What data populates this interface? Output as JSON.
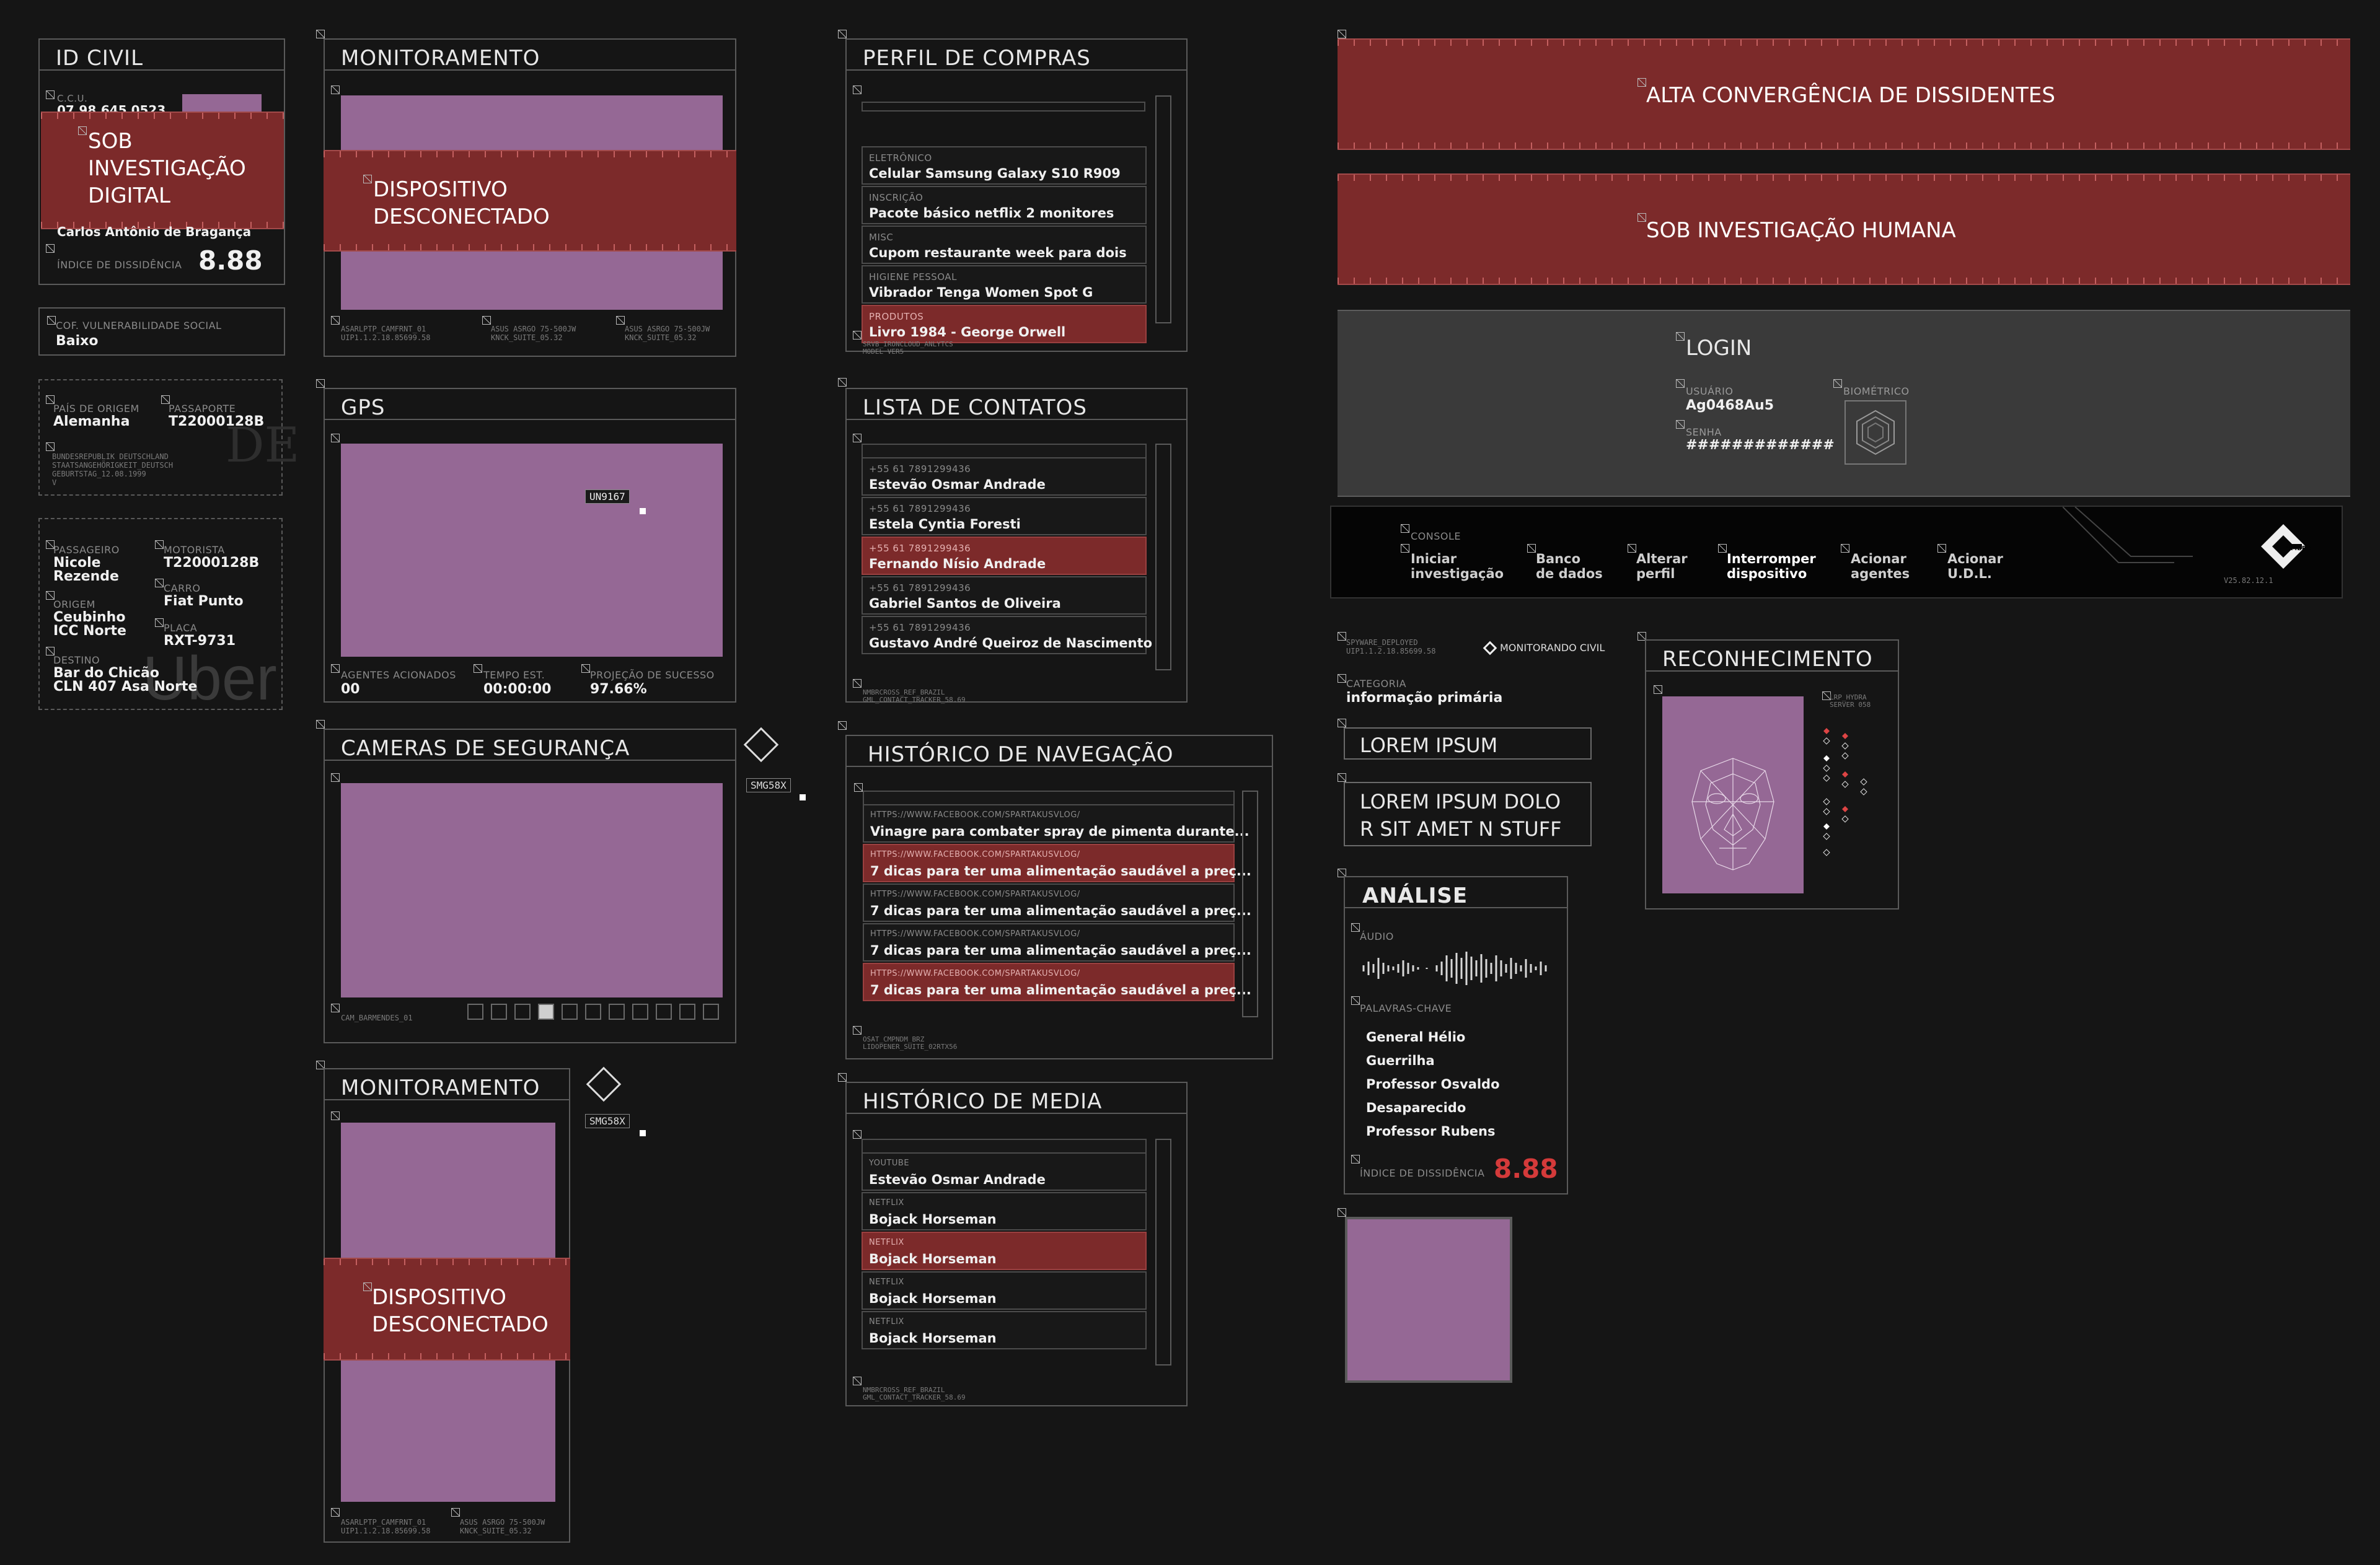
{
  "id_civil": {
    "title": "ID CIVIL",
    "ccu_label": "C.C.U.",
    "ccu_value": "07.98.645 0523",
    "alert": "SOB\nINVESTIGAÇÃO\nDIGITAL",
    "name": "Carlos Antônio de Bragança",
    "dissidence_label": "ÍNDICE DE DISSIDÊNCIA",
    "dissidence_value": "8.88"
  },
  "vulnerability": {
    "label": "COF. VULNERABILIDADE SOCIAL",
    "value": "Baixo"
  },
  "passport": {
    "origin_label": "PAÍS DE ORIGEM",
    "origin_value": "Alemanha",
    "passport_label": "PASSAPORTE",
    "passport_value": "T22000128B",
    "small": "BUNDESREPUBLIK DEUTSCHLAND\nSTAATSANGEHÖRIGKEIT_DEUTSCH\nGEBURTSTAG_12.08.1999\nV",
    "logo": "DE"
  },
  "uber": {
    "passenger_label": "PASSAGEIRO",
    "passenger_value": "Nicole\nRezende",
    "driver_label": "MOTORISTA",
    "driver_value": "T22000128B",
    "car_label": "CARRO",
    "car_value": "Fiat Punto",
    "origin_label": "ORIGEM",
    "origin_value": "Ceubinho\nICC Norte",
    "plate_label": "PLACA",
    "plate_value": "RXT-9731",
    "dest_label": "DESTINO",
    "dest_value": "Bar do Chicão\nCLN 407 Asa Norte",
    "logo": "Uber"
  },
  "monitor1": {
    "title": "MONITORAMENTO",
    "alert": "DISPOSITIVO\nDESCONECTADO",
    "f1": "ASARLPTP_CAMFRNT_01\nUIP1.1.2.18.85699.58",
    "f2": "ASUS ASRGO 75-500JW\nKNCK_SUITE_05.32",
    "f3": "ASUS ASRGO 75-500JW\nKNCK_SUITE_05.32"
  },
  "gps": {
    "title": "GPS",
    "tag": "UN9167",
    "agents_label": "AGENTES ACIONADOS",
    "agents_value": "00",
    "time_label": "TEMPO EST.",
    "time_value": "00:00:00",
    "proj_label": "PROJEÇÃO DE SUCESSO",
    "proj_value": "97.66%"
  },
  "cameras": {
    "title": "CAMERAS DE SEGURANÇA",
    "footer": "CAM_BARMENDES_01",
    "tag": "SMG58X"
  },
  "monitor2": {
    "title": "MONITORAMENTO",
    "alert": "DISPOSITIVO\nDESCONECTADO",
    "f1": "ASARLPTP_CAMFRNT_01\nUIP1.1.2.18.85699.58",
    "f2": "ASUS ASRGO 75-500JW\nKNCK_SUITE_05.32",
    "tag": "SMG58X"
  },
  "compras": {
    "title": "PERFIL DE COMPRAS",
    "rows": [
      {
        "cat": "ELETRÔNICO",
        "item": "Celular Samsung Galaxy S10 R909"
      },
      {
        "cat": "INSCRIÇÃO",
        "item": "Pacote básico netflix 2 monitores"
      },
      {
        "cat": "MISC",
        "item": "Cupom restaurante week para dois"
      },
      {
        "cat": "HIGIENE PESSOAL",
        "item": "Vibrador Tenga Women Spot G"
      },
      {
        "cat": "PRODUTOS",
        "item": "Livro 1984 - George Orwell"
      }
    ],
    "footer": "SRVB_IRONCLOUD_ANLYTCS\nMODEL VER5"
  },
  "contatos": {
    "title": "LISTA DE CONTATOS",
    "rows": [
      {
        "phone": "+55 61 7891299436",
        "name": "Estevão Osmar Andrade"
      },
      {
        "phone": "+55 61 7891299436",
        "name": "Estela Cyntia Foresti"
      },
      {
        "phone": "+55 61 7891299436",
        "name": "Fernando Nísio Andrade"
      },
      {
        "phone": "+55 61 7891299436",
        "name": "Gabriel Santos de Oliveira"
      },
      {
        "phone": "+55 61 7891299436",
        "name": "Gustavo André Queiroz de Nascimento"
      }
    ],
    "footer": "NMBRCROSS_REF_BRAZIL\nGML_CONTACT_TRACKER_58.69"
  },
  "navegacao": {
    "title": "HISTÓRICO DE NAVEGAÇÃO",
    "rows": [
      {
        "url": "HTTPS://WWW.FACEBOOK.COM/SPARTAKUSVLOG/",
        "text": "Vinagre para combater spray de pimenta durante..."
      },
      {
        "url": "HTTPS://WWW.FACEBOOK.COM/SPARTAKUSVLOG/",
        "text": "7 dicas para ter uma alimentação saudável a preç..."
      },
      {
        "url": "HTTPS://WWW.FACEBOOK.COM/SPARTAKUSVLOG/",
        "text": "7 dicas para ter uma alimentação saudável a preç..."
      },
      {
        "url": "HTTPS://WWW.FACEBOOK.COM/SPARTAKUSVLOG/",
        "text": "7 dicas para ter uma alimentação saudável a preç..."
      },
      {
        "url": "HTTPS://WWW.FACEBOOK.COM/SPARTAKUSVLOG/",
        "text": "7 dicas para ter uma alimentação saudável a preç..."
      }
    ],
    "footer": "OSAT_CMPNDM_BRZ\nLIDOPENER_SUITE_02RTX56"
  },
  "media": {
    "title": "HISTÓRICO DE MEDIA",
    "rows": [
      {
        "src": "YOUTUBE",
        "title": "Estevão Osmar Andrade"
      },
      {
        "src": "NETFLIX",
        "title": "Bojack Horseman"
      },
      {
        "src": "NETFLIX",
        "title": "Bojack Horseman"
      },
      {
        "src": "NETFLIX",
        "title": "Bojack Horseman"
      },
      {
        "src": "NETFLIX",
        "title": "Bojack Horseman"
      }
    ],
    "footer": "NMBRCROSS_REF_BRAZIL\nGML_CONTACT_TRACKER_58.69"
  },
  "banner1": "ALTA CONVERGÊNCIA DE DISSIDENTES",
  "banner2": "SOB INVESTIGAÇÃO HUMANA",
  "login": {
    "title": "LOGIN",
    "user_label": "USUÁRIO",
    "user_value": "Ag0468Au5",
    "pass_label": "SENHA",
    "pass_value": "#############",
    "bio_label": "BIOMÉTRICO"
  },
  "console": {
    "label": "CONSOLE",
    "buttons": [
      "Iniciar\ninvestigação",
      "Banco\nde dados",
      "Alterar\nperfil",
      "Interromper\ndispositivo",
      "Acionar\nagentes",
      "Acionar\nU.D.L."
    ],
    "brand": "UMBRA",
    "version": "V25.82.12.1"
  },
  "spyware": {
    "small": "SPYWARE_DEPLOYED\nUIP1.1.2.18.85699.58",
    "monitor": "MONITORANDO CIVIL",
    "cat_label": "CATEGORIA",
    "cat_value": "informação primária",
    "box1": "LOREM IPSUM",
    "box2": "LOREM IPSUM DOLO\nR SIT AMET N STUFF"
  },
  "analise": {
    "title": "ANÁLISE",
    "audio_label": "ÁUDIO",
    "kw_label": "PALAVRAS-CHAVE",
    "keywords": [
      "General Hélio",
      "Guerrilha",
      "Professor Osvaldo",
      "Desaparecido",
      "Professor Rubens"
    ],
    "dissidence_label": "ÍNDICE DE DISSIDÊNCIA",
    "dissidence_value": "8.88"
  },
  "reconhecimento": {
    "title": "RECONHECIMENTO",
    "server": "LRP_HYDRA\nSERVER 058"
  },
  "colors": {
    "alert": "#7c2a2a",
    "screen": "#956895",
    "panel": "#5a5a5a",
    "accent_red": "#d43a3a"
  }
}
